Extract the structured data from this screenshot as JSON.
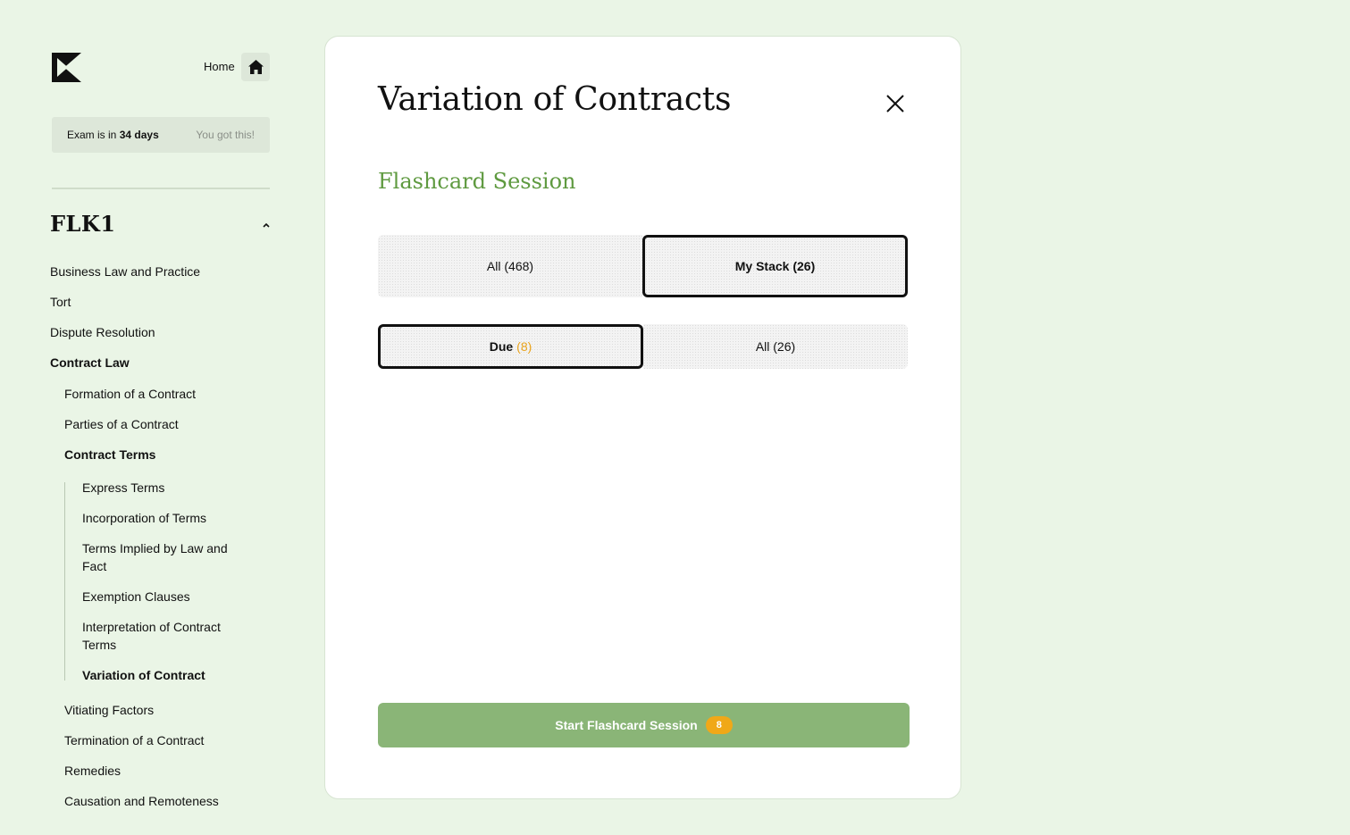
{
  "header": {
    "logo_icon": "k-logo-icon",
    "home_label": "Home",
    "home_icon": "home-icon"
  },
  "exam_banner": {
    "prefix": "Exam is in",
    "days": "34 days",
    "encouragement": "You got this!"
  },
  "sidebar": {
    "course_title": "FLK1",
    "items": [
      {
        "label": "Business Law and Practice"
      },
      {
        "label": "Tort"
      },
      {
        "label": "Dispute Resolution"
      },
      {
        "label": "Contract Law"
      },
      {
        "label": "Formation of a Contract"
      },
      {
        "label": "Parties of a Contract"
      },
      {
        "label": "Contract Terms"
      },
      {
        "label": "Express Terms"
      },
      {
        "label": "Incorporation of Terms"
      },
      {
        "label": "Terms Implied by Law and Fact"
      },
      {
        "label": "Exemption Clauses"
      },
      {
        "label": "Interpretation of Contract Terms"
      },
      {
        "label": "Variation of Contract"
      },
      {
        "label": "Vitiating Factors"
      },
      {
        "label": "Termination of a Contract"
      },
      {
        "label": "Remedies"
      },
      {
        "label": "Causation and Remoteness"
      }
    ]
  },
  "modal": {
    "title": "Variation of Contracts",
    "section_title": "Flashcard Session",
    "scope_options": [
      {
        "label": "All (468)",
        "selected": false
      },
      {
        "label": "My Stack (26)",
        "selected": true
      }
    ],
    "filter_options": [
      {
        "label": "Due",
        "count": "(8)",
        "selected": true
      },
      {
        "label": "All (26)",
        "selected": false
      }
    ],
    "start_button": {
      "label": "Start Flashcard Session",
      "badge": "8"
    }
  },
  "colors": {
    "background": "#eaf5e6",
    "accent_green": "#5f9a40",
    "button_green": "#8ab577",
    "badge_orange": "#f0a818"
  }
}
